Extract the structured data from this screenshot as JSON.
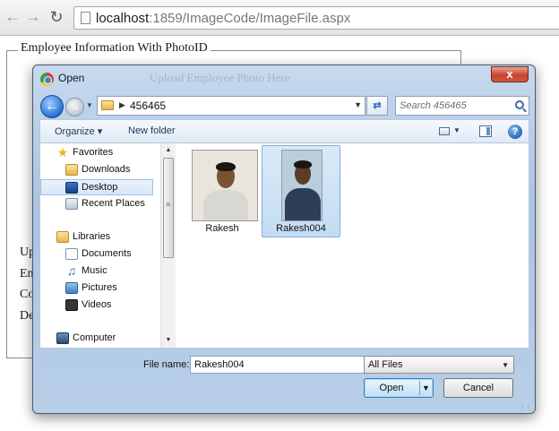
{
  "browser": {
    "url_host": "localhost",
    "url_path": ":1859/ImageCode/ImageFile.aspx"
  },
  "page": {
    "legend": "Employee Information With PhotoID",
    "left_labels": [
      "Up",
      "Em",
      "Co",
      "De"
    ]
  },
  "dialog": {
    "title": "Open",
    "close_label": "x",
    "ghost_title": "Upload Employee Photo Here",
    "breadcrumb": "456465",
    "search_placeholder": "Search 456465",
    "organize_label": "Organize ▾",
    "new_folder_label": "New folder",
    "help_label": "?",
    "nav": {
      "favorites": "Favorites",
      "downloads": "Downloads",
      "desktop": "Desktop",
      "recent": "Recent Places",
      "libraries": "Libraries",
      "documents": "Documents",
      "music": "Music",
      "pictures": "Pictures",
      "videos": "Videos",
      "computer": "Computer"
    },
    "files": [
      {
        "name": "Rakesh",
        "selected": false
      },
      {
        "name": "Rakesh004",
        "selected": true
      }
    ],
    "filename_label": "File name:",
    "filename_value": "Rakesh004",
    "filetype_value": "All Files",
    "open_label": "Open",
    "cancel_label": "Cancel"
  }
}
